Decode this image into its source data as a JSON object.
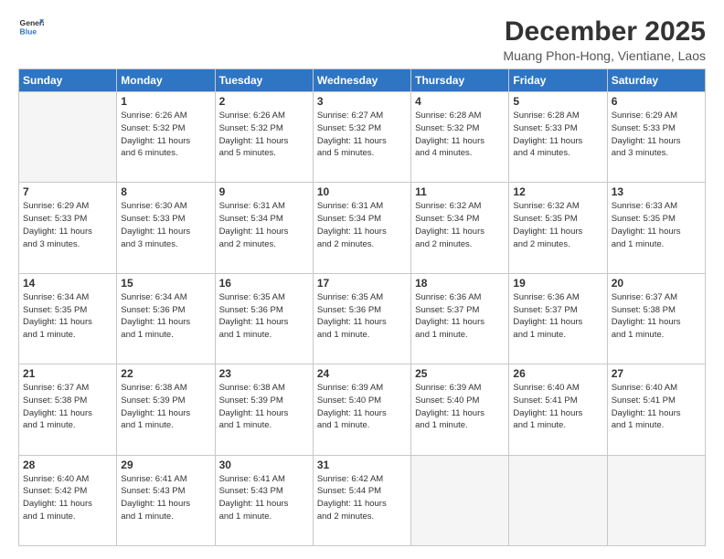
{
  "logo": {
    "line1": "General",
    "line2": "Blue"
  },
  "title": "December 2025",
  "location": "Muang Phon-Hong, Vientiane, Laos",
  "days_header": [
    "Sunday",
    "Monday",
    "Tuesday",
    "Wednesday",
    "Thursday",
    "Friday",
    "Saturday"
  ],
  "weeks": [
    [
      {
        "num": "",
        "detail": ""
      },
      {
        "num": "1",
        "detail": "Sunrise: 6:26 AM\nSunset: 5:32 PM\nDaylight: 11 hours\nand 6 minutes."
      },
      {
        "num": "2",
        "detail": "Sunrise: 6:26 AM\nSunset: 5:32 PM\nDaylight: 11 hours\nand 5 minutes."
      },
      {
        "num": "3",
        "detail": "Sunrise: 6:27 AM\nSunset: 5:32 PM\nDaylight: 11 hours\nand 5 minutes."
      },
      {
        "num": "4",
        "detail": "Sunrise: 6:28 AM\nSunset: 5:32 PM\nDaylight: 11 hours\nand 4 minutes."
      },
      {
        "num": "5",
        "detail": "Sunrise: 6:28 AM\nSunset: 5:33 PM\nDaylight: 11 hours\nand 4 minutes."
      },
      {
        "num": "6",
        "detail": "Sunrise: 6:29 AM\nSunset: 5:33 PM\nDaylight: 11 hours\nand 3 minutes."
      }
    ],
    [
      {
        "num": "7",
        "detail": "Sunrise: 6:29 AM\nSunset: 5:33 PM\nDaylight: 11 hours\nand 3 minutes."
      },
      {
        "num": "8",
        "detail": "Sunrise: 6:30 AM\nSunset: 5:33 PM\nDaylight: 11 hours\nand 3 minutes."
      },
      {
        "num": "9",
        "detail": "Sunrise: 6:31 AM\nSunset: 5:34 PM\nDaylight: 11 hours\nand 2 minutes."
      },
      {
        "num": "10",
        "detail": "Sunrise: 6:31 AM\nSunset: 5:34 PM\nDaylight: 11 hours\nand 2 minutes."
      },
      {
        "num": "11",
        "detail": "Sunrise: 6:32 AM\nSunset: 5:34 PM\nDaylight: 11 hours\nand 2 minutes."
      },
      {
        "num": "12",
        "detail": "Sunrise: 6:32 AM\nSunset: 5:35 PM\nDaylight: 11 hours\nand 2 minutes."
      },
      {
        "num": "13",
        "detail": "Sunrise: 6:33 AM\nSunset: 5:35 PM\nDaylight: 11 hours\nand 1 minute."
      }
    ],
    [
      {
        "num": "14",
        "detail": "Sunrise: 6:34 AM\nSunset: 5:35 PM\nDaylight: 11 hours\nand 1 minute."
      },
      {
        "num": "15",
        "detail": "Sunrise: 6:34 AM\nSunset: 5:36 PM\nDaylight: 11 hours\nand 1 minute."
      },
      {
        "num": "16",
        "detail": "Sunrise: 6:35 AM\nSunset: 5:36 PM\nDaylight: 11 hours\nand 1 minute."
      },
      {
        "num": "17",
        "detail": "Sunrise: 6:35 AM\nSunset: 5:36 PM\nDaylight: 11 hours\nand 1 minute."
      },
      {
        "num": "18",
        "detail": "Sunrise: 6:36 AM\nSunset: 5:37 PM\nDaylight: 11 hours\nand 1 minute."
      },
      {
        "num": "19",
        "detail": "Sunrise: 6:36 AM\nSunset: 5:37 PM\nDaylight: 11 hours\nand 1 minute."
      },
      {
        "num": "20",
        "detail": "Sunrise: 6:37 AM\nSunset: 5:38 PM\nDaylight: 11 hours\nand 1 minute."
      }
    ],
    [
      {
        "num": "21",
        "detail": "Sunrise: 6:37 AM\nSunset: 5:38 PM\nDaylight: 11 hours\nand 1 minute."
      },
      {
        "num": "22",
        "detail": "Sunrise: 6:38 AM\nSunset: 5:39 PM\nDaylight: 11 hours\nand 1 minute."
      },
      {
        "num": "23",
        "detail": "Sunrise: 6:38 AM\nSunset: 5:39 PM\nDaylight: 11 hours\nand 1 minute."
      },
      {
        "num": "24",
        "detail": "Sunrise: 6:39 AM\nSunset: 5:40 PM\nDaylight: 11 hours\nand 1 minute."
      },
      {
        "num": "25",
        "detail": "Sunrise: 6:39 AM\nSunset: 5:40 PM\nDaylight: 11 hours\nand 1 minute."
      },
      {
        "num": "26",
        "detail": "Sunrise: 6:40 AM\nSunset: 5:41 PM\nDaylight: 11 hours\nand 1 minute."
      },
      {
        "num": "27",
        "detail": "Sunrise: 6:40 AM\nSunset: 5:41 PM\nDaylight: 11 hours\nand 1 minute."
      }
    ],
    [
      {
        "num": "28",
        "detail": "Sunrise: 6:40 AM\nSunset: 5:42 PM\nDaylight: 11 hours\nand 1 minute."
      },
      {
        "num": "29",
        "detail": "Sunrise: 6:41 AM\nSunset: 5:43 PM\nDaylight: 11 hours\nand 1 minute."
      },
      {
        "num": "30",
        "detail": "Sunrise: 6:41 AM\nSunset: 5:43 PM\nDaylight: 11 hours\nand 1 minute."
      },
      {
        "num": "31",
        "detail": "Sunrise: 6:42 AM\nSunset: 5:44 PM\nDaylight: 11 hours\nand 2 minutes."
      },
      {
        "num": "",
        "detail": ""
      },
      {
        "num": "",
        "detail": ""
      },
      {
        "num": "",
        "detail": ""
      }
    ]
  ]
}
